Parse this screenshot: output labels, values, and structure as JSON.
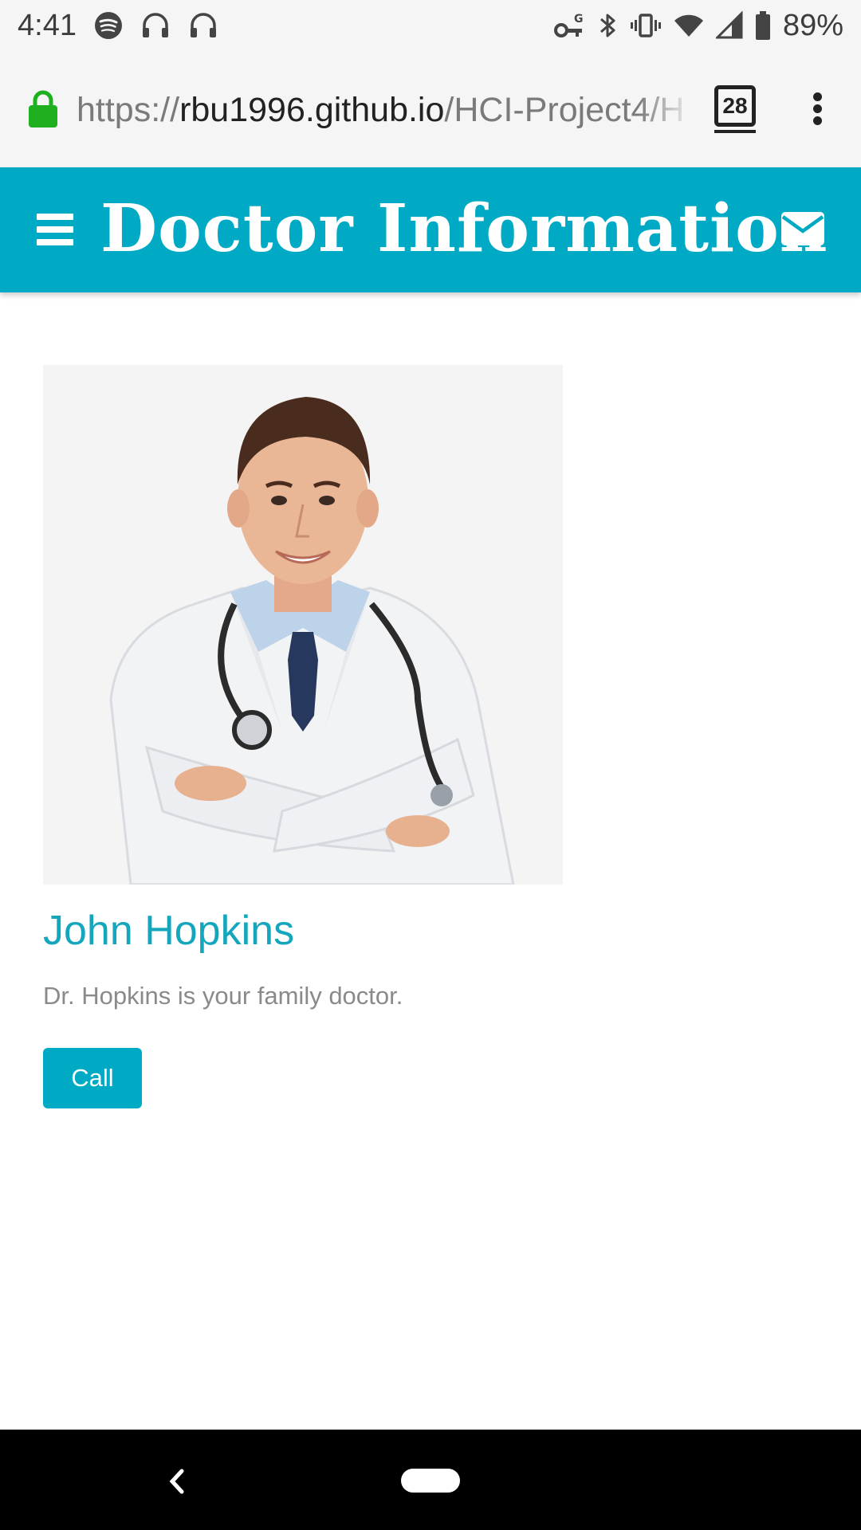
{
  "status_bar": {
    "time": "4:41",
    "battery": "89%",
    "icons": [
      "spotify-icon",
      "headphones-icon",
      "headphones-icon",
      "vpn-key-icon",
      "bluetooth-icon",
      "vibrate-icon",
      "wifi-icon",
      "cell-signal-icon",
      "battery-icon"
    ]
  },
  "browser": {
    "url_scheme": "https://",
    "url_host": "rbu1996.github.io",
    "url_path": "/HCI-Project4/H",
    "tab_count": "28",
    "icons": [
      "lock-icon",
      "overflow-menu-icon"
    ]
  },
  "header": {
    "title": "Doctor Information",
    "accent_color": "#00a9c4",
    "icons": [
      "hamburger-menu-icon",
      "mail-icon"
    ]
  },
  "doctor": {
    "name": "John Hopkins",
    "description": "Dr. Hopkins is your family doctor.",
    "call_label": "Call",
    "name_color": "#13a6bd"
  },
  "nav_bar": {
    "icons": [
      "back-icon",
      "home-pill-icon"
    ]
  }
}
